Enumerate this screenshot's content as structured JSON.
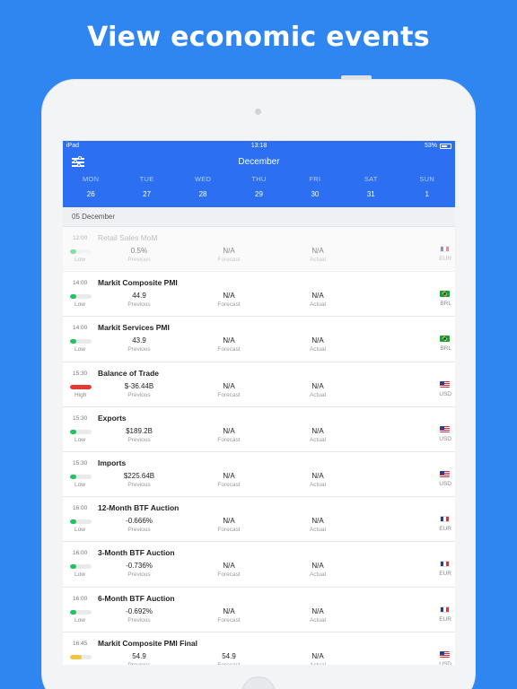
{
  "headline": "View economic events",
  "status_bar": {
    "device": "iPad",
    "time": "13:18",
    "battery": "53%"
  },
  "header": {
    "month": "December"
  },
  "week": [
    {
      "name": "MON",
      "date": "26"
    },
    {
      "name": "TUE",
      "date": "27"
    },
    {
      "name": "WED",
      "date": "28"
    },
    {
      "name": "THU",
      "date": "29"
    },
    {
      "name": "FRI",
      "date": "30"
    },
    {
      "name": "SAT",
      "date": "31"
    },
    {
      "name": "SUN",
      "date": "1"
    }
  ],
  "section_date": "05 December",
  "labels": {
    "previous": "Previous",
    "forecast": "Forecast",
    "actual": "Actual"
  },
  "colors": {
    "low": "#21c55d",
    "high": "#e53935",
    "medium": "#f5c542",
    "accent": "#2c6ff0"
  },
  "events": [
    {
      "time": "12:00",
      "name": "Retail Sales MoM",
      "importance": "Low",
      "level": "low",
      "previous": "0.5%",
      "forecast": "N/A",
      "actual": "N/A",
      "flag": "fr-flag-icon",
      "currency": "EUR",
      "past": true
    },
    {
      "time": "14:00",
      "name": "Markit Composite PMI",
      "importance": "Low",
      "level": "low",
      "previous": "44.9",
      "forecast": "N/A",
      "actual": "N/A",
      "flag": "br-flag-icon",
      "currency": "BRL"
    },
    {
      "time": "14:00",
      "name": "Markit Services PMI",
      "importance": "Low",
      "level": "low",
      "previous": "43.9",
      "forecast": "N/A",
      "actual": "N/A",
      "flag": "br-flag-icon",
      "currency": "BRL"
    },
    {
      "time": "15:30",
      "name": "Balance of Trade",
      "importance": "High",
      "level": "high",
      "previous": "$-36.44B",
      "forecast": "N/A",
      "actual": "N/A",
      "flag": "us-flag-icon",
      "currency": "USD"
    },
    {
      "time": "15:30",
      "name": "Exports",
      "importance": "Low",
      "level": "low",
      "previous": "$189.2B",
      "forecast": "N/A",
      "actual": "N/A",
      "flag": "us-flag-icon",
      "currency": "USD"
    },
    {
      "time": "15:30",
      "name": "Imports",
      "importance": "Low",
      "level": "low",
      "previous": "$225.64B",
      "forecast": "N/A",
      "actual": "N/A",
      "flag": "us-flag-icon",
      "currency": "USD"
    },
    {
      "time": "16:00",
      "name": "12-Month BTF Auction",
      "importance": "Low",
      "level": "low",
      "previous": "-0.666%",
      "forecast": "N/A",
      "actual": "N/A",
      "flag": "fr-flag-icon",
      "currency": "EUR"
    },
    {
      "time": "16:00",
      "name": "3-Month BTF Auction",
      "importance": "Low",
      "level": "low",
      "previous": "-0.736%",
      "forecast": "N/A",
      "actual": "N/A",
      "flag": "fr-flag-icon",
      "currency": "EUR"
    },
    {
      "time": "16:00",
      "name": "6-Month BTF Auction",
      "importance": "Low",
      "level": "low",
      "previous": "-0.692%",
      "forecast": "N/A",
      "actual": "N/A",
      "flag": "fr-flag-icon",
      "currency": "EUR"
    },
    {
      "time": "16:45",
      "name": "Markit Composite PMI Final",
      "importance": "",
      "level": "medium",
      "previous": "54.9",
      "forecast": "54.9",
      "actual": "N/A",
      "flag": "us-flag-icon",
      "currency": "USD"
    }
  ]
}
